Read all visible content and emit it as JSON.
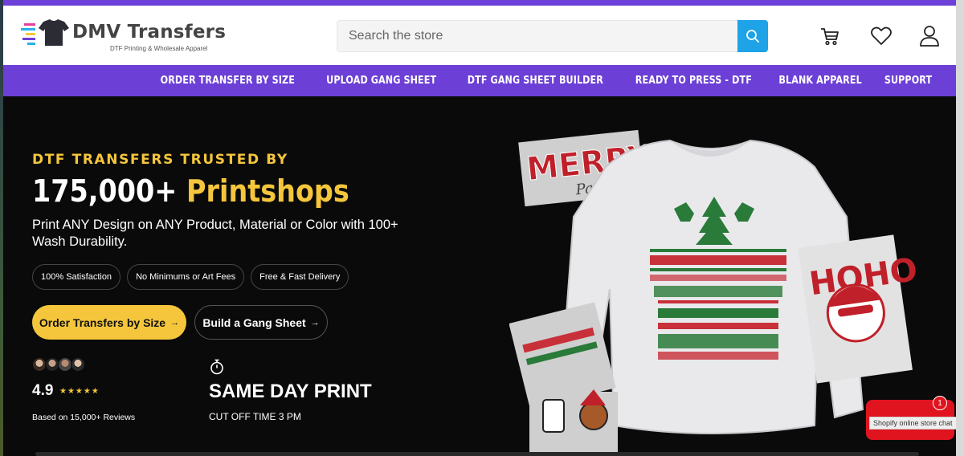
{
  "header": {
    "logo_title": "DMV Transfers",
    "logo_subtitle": "DTF Printing & Wholesale Apparel",
    "search_placeholder": "Search the store"
  },
  "nav": {
    "items": [
      {
        "label": "ORDER TRANSFER BY SIZE"
      },
      {
        "label": "UPLOAD GANG SHEET"
      },
      {
        "label": "DTF GANG SHEET BUILDER"
      },
      {
        "label": "READY TO PRESS - DTF"
      },
      {
        "label": "BLANK APPAREL"
      },
      {
        "label": "SUPPORT"
      }
    ]
  },
  "hero": {
    "eyebrow": "DTF TRANSFERS TRUSTED BY",
    "headline_number": "175,000+",
    "headline_word": "Printshops",
    "description": "Print ANY Design on ANY Product, Material or Color with 100+ Wash Durability.",
    "pills": [
      "100% Satisfaction",
      "No Minimums or Art Fees",
      "Free & Fast Delivery"
    ],
    "cta_primary": "Order Transfers by Size",
    "cta_secondary": "Build a Gang Sheet",
    "rating_value": "4.9",
    "stars": "★★★★★",
    "reviews_text": "Based on 15,000+ Reviews",
    "same_day_title": "SAME DAY PRINT",
    "cutoff_text": "CUT OFF TIME 3 PM",
    "art": {
      "merry_text": "MERRY",
      "papa_text": "Papa",
      "hoho_text": "HOHO"
    }
  },
  "chat": {
    "badge_count": "1",
    "tooltip": "Shopify online store chat"
  },
  "colors": {
    "brand_purple": "#6c3fd6",
    "accent_yellow": "#f5c63c",
    "search_blue": "#1ea3e6",
    "chat_red": "#e0141e"
  }
}
